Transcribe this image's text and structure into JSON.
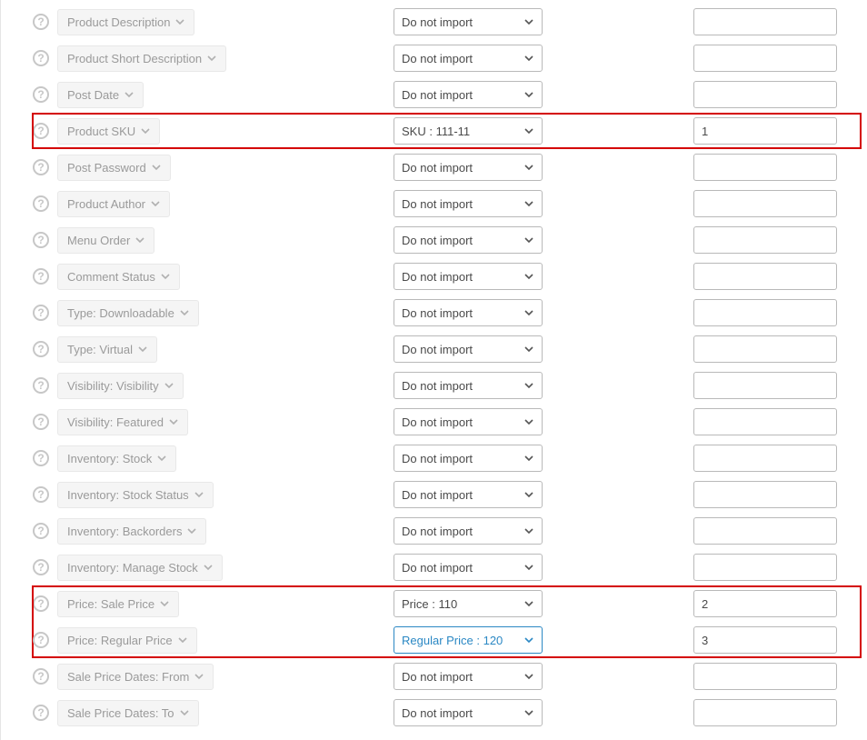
{
  "default_select": "Do not import",
  "rows": [
    {
      "label": "Product Description",
      "select": "Do not import",
      "input": "",
      "highlight": null,
      "active": false
    },
    {
      "label": "Product Short Description",
      "select": "Do not import",
      "input": "",
      "highlight": null,
      "active": false
    },
    {
      "label": "Post Date",
      "select": "Do not import",
      "input": "",
      "highlight": null,
      "active": false
    },
    {
      "label": "Product SKU",
      "select": "SKU   :   111-11",
      "input": "1",
      "highlight": "single",
      "active": false
    },
    {
      "label": "Post Password",
      "select": "Do not import",
      "input": "",
      "highlight": null,
      "active": false
    },
    {
      "label": "Product Author",
      "select": "Do not import",
      "input": "",
      "highlight": null,
      "active": false
    },
    {
      "label": "Menu Order",
      "select": "Do not import",
      "input": "",
      "highlight": null,
      "active": false
    },
    {
      "label": "Comment Status",
      "select": "Do not import",
      "input": "",
      "highlight": null,
      "active": false
    },
    {
      "label": "Type: Downloadable",
      "select": "Do not import",
      "input": "",
      "highlight": null,
      "active": false
    },
    {
      "label": "Type: Virtual",
      "select": "Do not import",
      "input": "",
      "highlight": null,
      "active": false
    },
    {
      "label": "Visibility: Visibility",
      "select": "Do not import",
      "input": "",
      "highlight": null,
      "active": false
    },
    {
      "label": "Visibility: Featured",
      "select": "Do not import",
      "input": "",
      "highlight": null,
      "active": false
    },
    {
      "label": "Inventory: Stock",
      "select": "Do not import",
      "input": "",
      "highlight": null,
      "active": false
    },
    {
      "label": "Inventory: Stock Status",
      "select": "Do not import",
      "input": "",
      "highlight": null,
      "active": false
    },
    {
      "label": "Inventory: Backorders",
      "select": "Do not import",
      "input": "",
      "highlight": null,
      "active": false
    },
    {
      "label": "Inventory: Manage Stock",
      "select": "Do not import",
      "input": "",
      "highlight": null,
      "active": false
    },
    {
      "label": "Price: Sale Price",
      "select": "Price   :   110",
      "input": "2",
      "highlight": "double",
      "active": false
    },
    {
      "label": "Price: Regular Price",
      "select": "Regular Price   :   120",
      "input": "3",
      "highlight": null,
      "active": true
    },
    {
      "label": "Sale Price Dates: From",
      "select": "Do not import",
      "input": "",
      "highlight": null,
      "active": false
    },
    {
      "label": "Sale Price Dates: To",
      "select": "Do not import",
      "input": "",
      "highlight": null,
      "active": false
    }
  ]
}
